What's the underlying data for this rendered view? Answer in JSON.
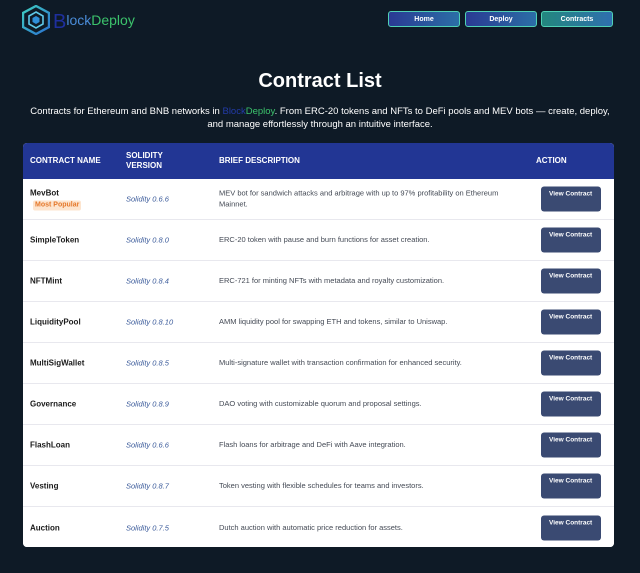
{
  "header": {
    "brand_b": "B",
    "brand_lock": "lock",
    "brand_deploy": "Deploy",
    "nav": [
      {
        "label": "Home"
      },
      {
        "label": "Deploy"
      },
      {
        "label": "Contracts"
      }
    ]
  },
  "title": "Contract List",
  "intro": {
    "before": "Contracts for Ethereum and BNB networks in ",
    "brand_b": "Block",
    "brand_deploy": "Deploy",
    "after": ". From ERC-20 tokens and NFTs to DeFi pools and MEV bots — create, deploy, and manage effortlessly through an intuitive interface."
  },
  "table": {
    "headers": {
      "name": "CONTRACT NAME",
      "version": "SOLIDITY VERSION",
      "description": "BRIEF DESCRIPTION",
      "action": "ACTION"
    },
    "rows": [
      {
        "name": "MevBot",
        "badge": "Most Popular",
        "version": "Solidity 0.6.6",
        "description": "MEV bot for sandwich attacks and arbitrage with up to 97% profitability on Ethereum Mainnet.",
        "action": "View Contract"
      },
      {
        "name": "SimpleToken",
        "version": "Solidity 0.8.0",
        "description": "ERC-20 token with pause and burn functions for asset creation.",
        "action": "View Contract"
      },
      {
        "name": "NFTMint",
        "version": "Solidity 0.8.4",
        "description": "ERC-721 for minting NFTs with metadata and royalty customization.",
        "action": "View Contract"
      },
      {
        "name": "LiquidityPool",
        "version": "Solidity 0.8.10",
        "description": "AMM liquidity pool for swapping ETH and tokens, similar to Uniswap.",
        "action": "View Contract"
      },
      {
        "name": "MultiSigWallet",
        "version": "Solidity 0.8.5",
        "description": "Multi-signature wallet with transaction confirmation for enhanced security.",
        "action": "View Contract"
      },
      {
        "name": "Governance",
        "version": "Solidity 0.8.9",
        "description": "DAO voting with customizable quorum and proposal settings.",
        "action": "View Contract"
      },
      {
        "name": "FlashLoan",
        "version": "Solidity 0.6.6",
        "description": "Flash loans for arbitrage and DeFi with Aave integration.",
        "action": "View Contract"
      },
      {
        "name": "Vesting",
        "version": "Solidity 0.8.7",
        "description": "Token vesting with flexible schedules for teams and investors.",
        "action": "View Contract"
      },
      {
        "name": "Auction",
        "version": "Solidity 0.7.5",
        "description": "Dutch auction with automatic price reduction for assets.",
        "action": "View Contract"
      }
    ]
  },
  "colors": {
    "background": "#0e1a26",
    "table_header": "#223694",
    "button": "#3a4a72",
    "badge_bg": "#fde5cf",
    "badge_text": "#e5782a",
    "accent_green": "#3cc36c"
  },
  "icons": {
    "logo": "hexagon-logo-icon"
  }
}
